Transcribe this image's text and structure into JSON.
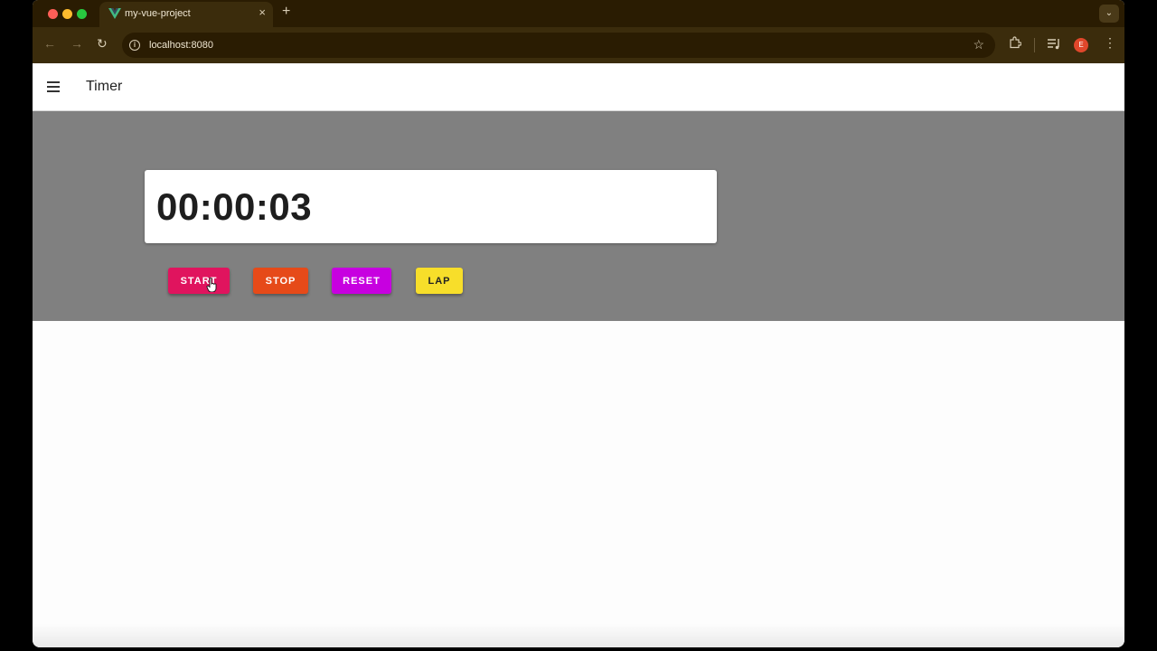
{
  "browser": {
    "tab_title": "my-vue-project",
    "tab_close": "×",
    "new_tab": "+",
    "tab_menu": "⌄",
    "url": "localhost:8080",
    "back": "←",
    "forward": "→",
    "reload": "↻",
    "star": "☆",
    "avatar_letter": "E",
    "menu": "⋮"
  },
  "app_bar": {
    "title": "Timer"
  },
  "timer": {
    "display": "00:00:03"
  },
  "buttons": {
    "start": "START",
    "stop": "STOP",
    "reset": "RESET",
    "lap": "LAP"
  },
  "colors": {
    "start": "#e0145e",
    "stop": "#e64a19",
    "reset": "#c700e0",
    "lap": "#f7de2a",
    "section_bg": "#808080"
  }
}
